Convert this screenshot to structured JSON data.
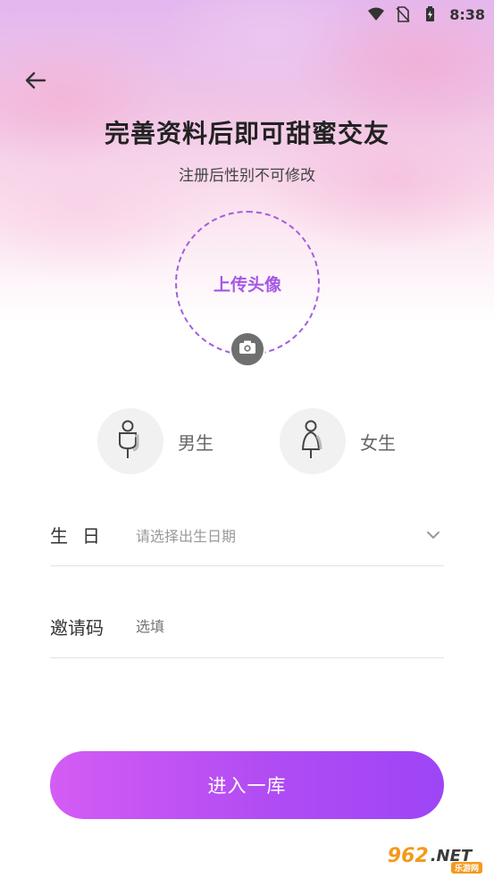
{
  "status_bar": {
    "time": "8:38",
    "icons": [
      "wifi-icon",
      "no-sim-icon",
      "battery-charging-icon"
    ]
  },
  "header": {
    "back_icon": "arrow-left-icon",
    "title": "完善资料后即可甜蜜交友",
    "subtitle": "注册后性别不可修改"
  },
  "avatar": {
    "label": "上传头像",
    "camera_icon": "camera-icon"
  },
  "gender": {
    "options": [
      {
        "label": "男生",
        "icon": "male-icon"
      },
      {
        "label": "女生",
        "icon": "female-icon"
      }
    ]
  },
  "form": {
    "birthday": {
      "label": "生日",
      "placeholder": "请选择出生日期",
      "icon": "chevron-down-icon"
    },
    "invite": {
      "label": "邀请码",
      "placeholder": "选填"
    }
  },
  "submit": {
    "label": "进入一库"
  },
  "watermark": {
    "brand": "962",
    "suffix": ".NET",
    "sub": "乐游网"
  },
  "colors": {
    "accent": "#a557e6",
    "button_start": "#d45cf3",
    "button_end": "#9d45f6"
  }
}
